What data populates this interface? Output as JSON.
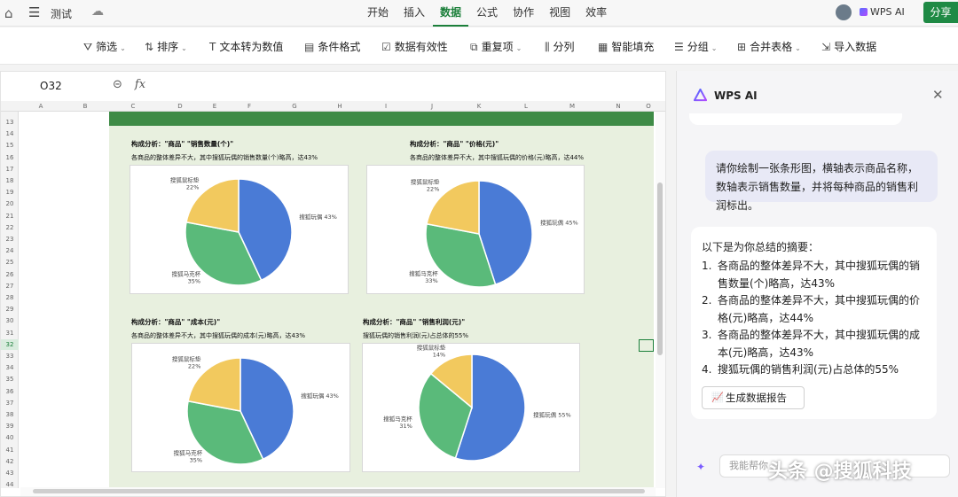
{
  "topbar": {
    "doc_title": "测试",
    "tabs": [
      {
        "label": "开始",
        "active": false
      },
      {
        "label": "插入",
        "active": false
      },
      {
        "label": "数据",
        "active": true
      },
      {
        "label": "公式",
        "active": false
      },
      {
        "label": "协作",
        "active": false
      },
      {
        "label": "视图",
        "active": false
      },
      {
        "label": "效率",
        "active": false
      }
    ],
    "wps_ai_label": "WPS AI",
    "share_label": "分享"
  },
  "toolbar": {
    "items": [
      {
        "label": "筛选",
        "icon": "filter-icon",
        "glyph": "⛛",
        "caret": true
      },
      {
        "label": "排序",
        "icon": "sort-icon",
        "glyph": "⇅",
        "caret": true
      },
      {
        "label": "文本转为数值",
        "icon": "text-to-number-icon",
        "glyph": "T",
        "caret": false
      },
      {
        "label": "条件格式",
        "icon": "conditional-format-icon",
        "glyph": "▤",
        "caret": false
      },
      {
        "label": "数据有效性",
        "icon": "validation-icon",
        "glyph": "☑",
        "caret": false
      },
      {
        "label": "重复项",
        "icon": "duplicates-icon",
        "glyph": "⧉",
        "caret": true
      },
      {
        "label": "分列",
        "icon": "split-column-icon",
        "glyph": "⫼",
        "caret": false
      },
      {
        "label": "智能填充",
        "icon": "smart-fill-icon",
        "glyph": "▦",
        "caret": false
      },
      {
        "label": "分组",
        "icon": "group-icon",
        "glyph": "☰",
        "caret": true
      },
      {
        "label": "合并表格",
        "icon": "merge-table-icon",
        "glyph": "⊞",
        "caret": true
      },
      {
        "label": "导入数据",
        "icon": "import-icon",
        "glyph": "⇲",
        "caret": false
      }
    ]
  },
  "sheet": {
    "name_box": "O32",
    "columns": [
      "A",
      "B",
      "C",
      "D",
      "E",
      "F",
      "G",
      "H",
      "I",
      "J",
      "K",
      "L",
      "M",
      "N",
      "O"
    ],
    "rows": [
      "13",
      "14",
      "15",
      "16",
      "17",
      "18",
      "19",
      "20",
      "21",
      "22",
      "23",
      "24",
      "25",
      "26",
      "27",
      "28",
      "29",
      "30",
      "31",
      "32",
      "33",
      "34",
      "35",
      "36",
      "37",
      "38",
      "39",
      "40",
      "41",
      "42",
      "43",
      "44"
    ],
    "selected_row": "32"
  },
  "chart_data": [
    {
      "type": "pie",
      "title": "构成分析：\"商品\" \"销售数量(个)\"",
      "subtitle": "各商品的整体差异不大，其中搜狐玩偶的销售数量(个)略高，达43%",
      "categories": [
        "搜狐玩偶",
        "搜狐马克杯",
        "搜狐鼠标垫"
      ],
      "values": [
        43,
        35,
        22
      ],
      "labels": [
        "搜狐玩偶 43%",
        "搜狐马克杯\n35%",
        "搜狐鼠标垫\n22%"
      ],
      "colors": [
        "#4a7bd6",
        "#5aba7a",
        "#f2c95e"
      ]
    },
    {
      "type": "pie",
      "title": "构成分析：\"商品\" \"价格(元)\"",
      "subtitle": "各商品的整体差异不大，其中搜狐玩偶的价格(元)略高，达44%",
      "categories": [
        "搜狐玩偶",
        "搜狐马克杯",
        "搜狐鼠标垫"
      ],
      "values": [
        45,
        33,
        22
      ],
      "labels": [
        "搜狐玩偶 45%",
        "搜狐马克杯\n33%",
        "搜狐鼠标垫\n22%"
      ],
      "colors": [
        "#4a7bd6",
        "#5aba7a",
        "#f2c95e"
      ]
    },
    {
      "type": "pie",
      "title": "构成分析：\"商品\" \"成本(元)\"",
      "subtitle": "各商品的整体差异不大，其中搜狐玩偶的成本(元)略高，达43%",
      "categories": [
        "搜狐玩偶",
        "搜狐马克杯",
        "搜狐鼠标垫"
      ],
      "values": [
        43,
        35,
        22
      ],
      "labels": [
        "搜狐玩偶 43%",
        "搜狐马克杯\n35%",
        "搜狐鼠标垫\n22%"
      ],
      "colors": [
        "#4a7bd6",
        "#5aba7a",
        "#f2c95e"
      ]
    },
    {
      "type": "pie",
      "title": "构成分析：\"商品\" \"销售利润(元)\"",
      "subtitle": "搜狐玩偶的销售利润(元)占总体的55%",
      "categories": [
        "搜狐玩偶",
        "搜狐马克杯",
        "搜狐鼠标垫"
      ],
      "values": [
        55,
        31,
        14
      ],
      "labels": [
        "搜狐玩偶 55%",
        "搜狐马克杯\n31%",
        "搜狐鼠标垫\n14%"
      ],
      "colors": [
        "#4a7bd6",
        "#5aba7a",
        "#f2c95e"
      ]
    }
  ],
  "panel": {
    "title": "WPS AI",
    "user_message": "请你绘制一张条形图，横轴表示商品名称，数轴表示销售数量，并将每种商品的销售利润标出。",
    "reply_intro": "以下是为你总结的摘要：",
    "reply_items": [
      "各商品的整体差异不大，其中搜狐玩偶的销售数量(个)略高，达43%",
      "各商品的整体差异不大，其中搜狐玩偶的价格(元)略高，达44%",
      "各商品的整体差异不大，其中搜狐玩偶的成本(元)略高，达43%",
      "搜狐玩偶的销售利润(元)占总体的55%"
    ],
    "generate_button": "生成数据报告",
    "input_placeholder": "我能帮你"
  },
  "watermark": "头条 @搜狐科技"
}
